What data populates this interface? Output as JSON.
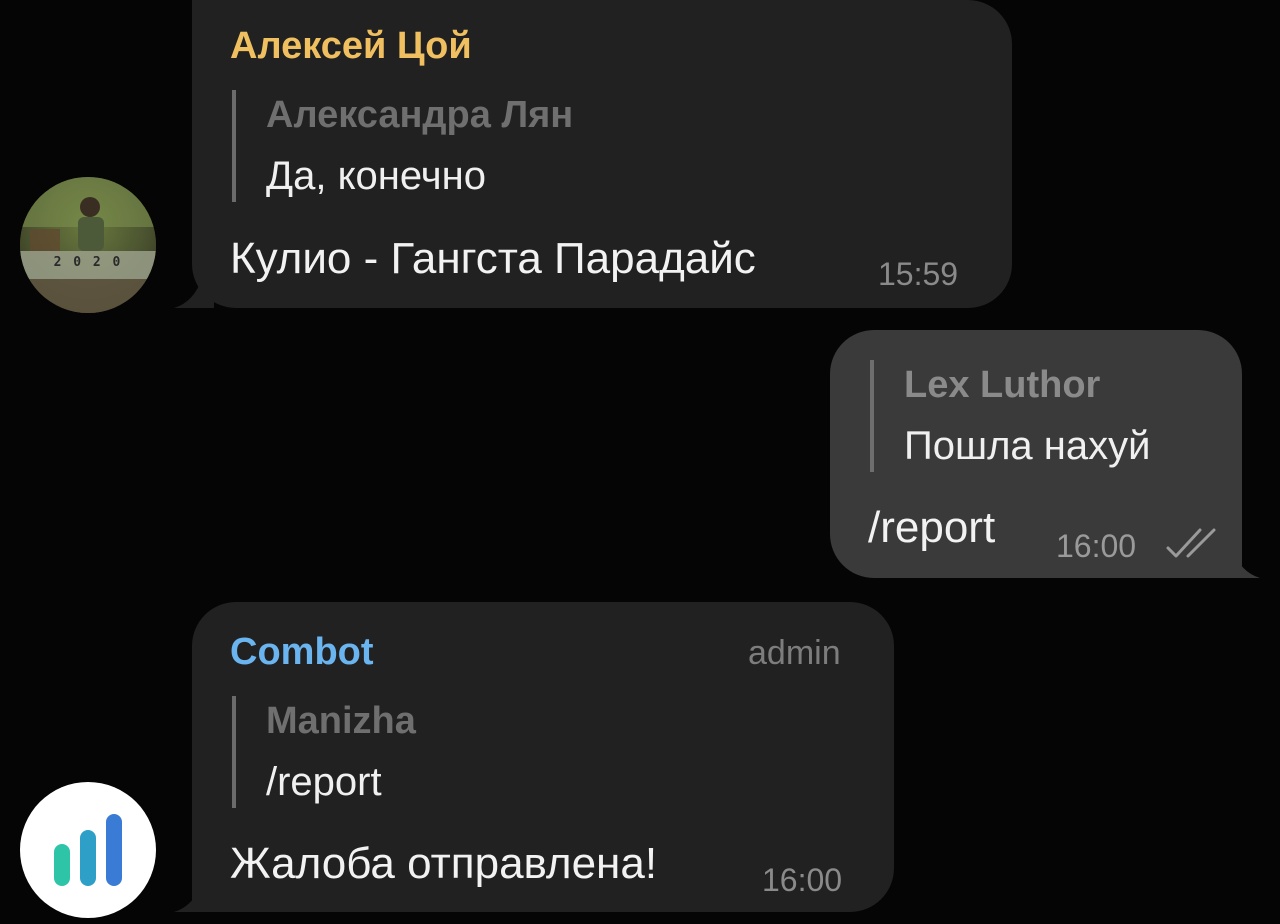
{
  "messages": [
    {
      "sender": "Алексей Цой",
      "sender_color": "#f0c060",
      "reply_name": "Александра Лян",
      "reply_text": "Да, конечно",
      "text": "Кулио - Гангста Парадайс",
      "time": "15:59",
      "avatar_icon": "user-photo-avatar",
      "avatar_caption": "2 0 2 0"
    },
    {
      "reply_name": "Lex Luthor",
      "reply_text": "Пошла нахуй",
      "text": "/report",
      "time": "16:00",
      "status_icon": "double-check-icon"
    },
    {
      "sender": "Combot",
      "sender_color": "#6ab4f0",
      "badge": "admin",
      "reply_name": "Manizha",
      "reply_text": "/report",
      "text": "Жалоба отправлена!",
      "time": "16:00",
      "avatar_icon": "bar-chart-logo-icon",
      "avatar_bar_color": "#2ec4a8",
      "avatar_bar_color2": "#3a7bd5"
    }
  ]
}
